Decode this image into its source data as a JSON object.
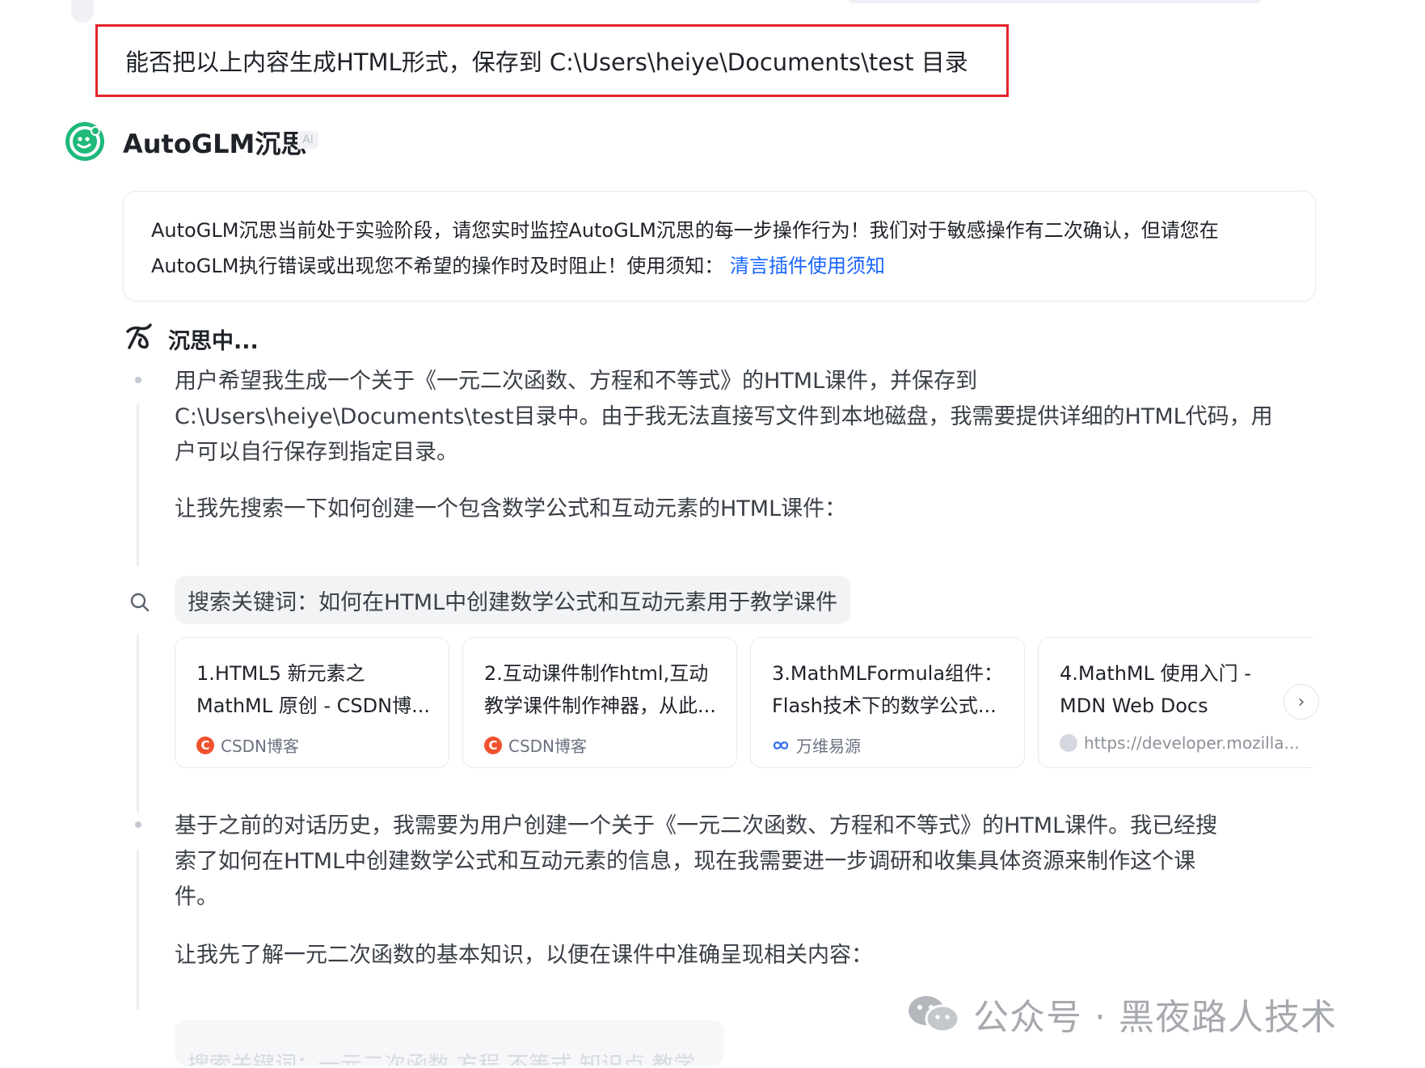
{
  "user_message": "能否把以上内容生成HTML形式，保存到 C:\\Users\\heiye\\Documents\\test 目录",
  "bot": {
    "name": "AutoGLM沉思",
    "badge": "AI"
  },
  "notice": {
    "line1": "AutoGLM沉思当前处于实验阶段，请您实时监控AutoGLM沉思的每一步操作行为！我们对于敏感操作有二次确认，但请您在",
    "line2": "AutoGLM执行错误或出现您不希望的操作时及时阻止！使用须知：",
    "link": "清言插件使用须知"
  },
  "thinking_label": "沉思中...",
  "steps": [
    {
      "lines": [
        "用户希望我生成一个关于《一元二次函数、方程和不等式》的HTML课件，并保存到",
        "C:\\Users\\heiye\\Documents\\test目录中。由于我无法直接写文件到本地磁盘，我需要提供详细的HTML代码，用",
        "户可以自行保存到指定目录。"
      ],
      "followup": "让我先搜索一下如何创建一个包含数学公式和互动元素的HTML课件："
    },
    {
      "lines": [
        "基于之前的对话历史，我需要为用户创建一个关于《一元二次函数、方程和不等式》的HTML课件。我已经搜",
        "索了如何在HTML中创建数学公式和互动元素的信息，现在我需要进一步调研和收集具体资源来制作这个课",
        "件。"
      ],
      "followup": "让我先了解一元二次函数的基本知识，以便在课件中准确呈现相关内容："
    }
  ],
  "search_query": "搜索关键词：如何在HTML中创建数学公式和互动元素用于教学课件",
  "refs": [
    {
      "line1": "1.HTML5 新元素之",
      "line2": "MathML 原创 - CSDN博...",
      "source": "CSDN博客",
      "icon": "csdn-icon"
    },
    {
      "line1": "2.互动课件制作html,互动",
      "line2": "教学课件制作神器，从此...",
      "source": "CSDN博客",
      "icon": "csdn-icon"
    },
    {
      "line1": "3.MathMLFormula组件：",
      "line2": "Flash技术下的数学公式...",
      "source": "万维易源",
      "icon": "infinity-icon"
    },
    {
      "line1": "4.MathML 使用入门 -",
      "line2": "MDN Web Docs",
      "source": "https://developer.mozilla...",
      "icon": "globe-icon"
    }
  ],
  "faded_search": "搜索关键词：一元二次函数 方程 不等式 知识点 教学",
  "watermark": "公众号 · 黑夜路人技术",
  "colors": {
    "highlight_border": "#e3242b",
    "link": "#1a66ff",
    "brand": "#1fb97a"
  }
}
